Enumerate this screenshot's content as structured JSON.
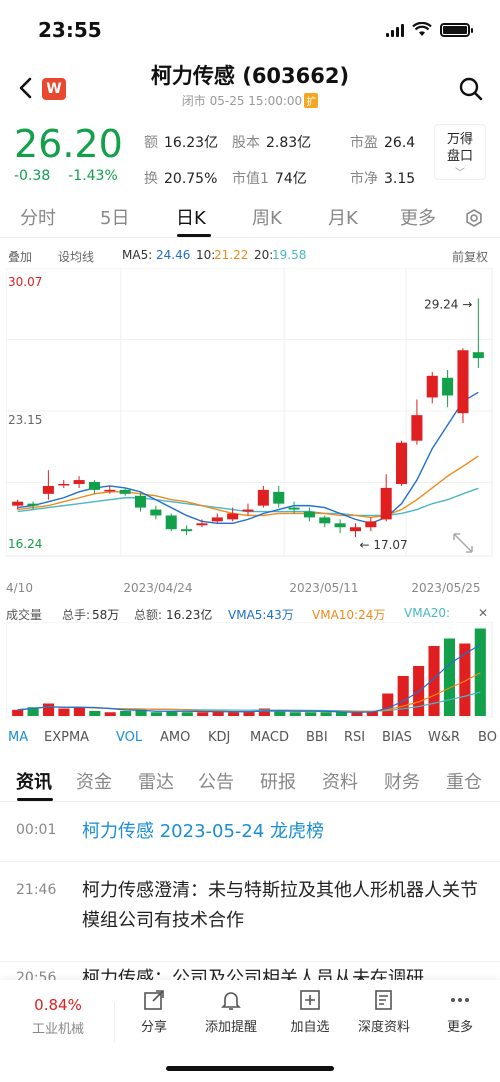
{
  "status_bar": {
    "time": "23:55"
  },
  "header": {
    "title": "柯力传感 (603662)",
    "subtitle": "闭市 05-25 15:00:00",
    "subtitle_badge": "扩",
    "logo": "W"
  },
  "quote": {
    "price": "26.20",
    "change": "-0.38",
    "change_pct": "-1.43%",
    "stats": [
      {
        "k": "额",
        "v": "16.23亿"
      },
      {
        "k": "股本",
        "v": "2.83亿"
      },
      {
        "k": "市盈",
        "v": "26.4"
      },
      {
        "k": "换",
        "v": "20.75%"
      },
      {
        "k": "市值1",
        "v": "74亿"
      },
      {
        "k": "市净",
        "v": "3.15"
      }
    ],
    "wande_btn": [
      "万得",
      "盘口"
    ]
  },
  "period_tabs": [
    "分时",
    "5日",
    "日K",
    "周K",
    "月K",
    "更多"
  ],
  "period_active": "日K",
  "ma_bar": {
    "overlay": "叠加",
    "set_line": "设均线",
    "ma5_label": "MA5:",
    "ma5": "24.46",
    "ma10_label": "10:",
    "ma10": "21.22",
    "ma20_label": "20:",
    "ma20": "19.58",
    "adjust": "前复权",
    "colors": {
      "ma5": "#1f6fd1",
      "ma10": "#f08a1a",
      "ma20": "#4ab7c8"
    }
  },
  "chart_data": {
    "type": "candlestick",
    "y_max_label": "30.07",
    "y_mid_label": "23.15",
    "y_min_label": "16.24",
    "ylim": [
      16.24,
      30.07
    ],
    "x_labels": [
      "4/10",
      "2023/04/24",
      "2023/05/11",
      "2023/05/25"
    ],
    "high_annotation": "29.24",
    "low_annotation": "17.07",
    "candles": [
      {
        "o": 18.7,
        "c": 18.9,
        "h": 19.0,
        "l": 18.5
      },
      {
        "o": 18.8,
        "c": 18.7,
        "h": 18.9,
        "l": 18.5
      },
      {
        "o": 19.3,
        "c": 19.7,
        "h": 20.5,
        "l": 19.0
      },
      {
        "o": 19.8,
        "c": 19.8,
        "h": 20.0,
        "l": 19.6
      },
      {
        "o": 19.8,
        "c": 20.0,
        "h": 20.2,
        "l": 19.6
      },
      {
        "o": 19.9,
        "c": 19.5,
        "h": 20.0,
        "l": 19.3
      },
      {
        "o": 19.5,
        "c": 19.5,
        "h": 19.7,
        "l": 19.3
      },
      {
        "o": 19.5,
        "c": 19.3,
        "h": 19.6,
        "l": 19.2
      },
      {
        "o": 19.2,
        "c": 18.6,
        "h": 19.4,
        "l": 18.4
      },
      {
        "o": 18.5,
        "c": 18.2,
        "h": 18.7,
        "l": 18.0
      },
      {
        "o": 18.2,
        "c": 17.5,
        "h": 18.3,
        "l": 17.4
      },
      {
        "o": 17.5,
        "c": 17.4,
        "h": 17.7,
        "l": 17.2
      },
      {
        "o": 17.7,
        "c": 17.8,
        "h": 18.0,
        "l": 17.6
      },
      {
        "o": 17.9,
        "c": 18.1,
        "h": 18.3,
        "l": 17.8
      },
      {
        "o": 18.0,
        "c": 18.3,
        "h": 18.6,
        "l": 17.9
      },
      {
        "o": 18.4,
        "c": 18.5,
        "h": 18.8,
        "l": 18.2
      },
      {
        "o": 18.7,
        "c": 19.5,
        "h": 19.7,
        "l": 18.6
      },
      {
        "o": 19.4,
        "c": 18.8,
        "h": 19.7,
        "l": 18.6
      },
      {
        "o": 18.6,
        "c": 18.5,
        "h": 18.9,
        "l": 18.3
      },
      {
        "o": 18.4,
        "c": 18.1,
        "h": 18.6,
        "l": 17.9
      },
      {
        "o": 18.1,
        "c": 17.8,
        "h": 18.2,
        "l": 17.6
      },
      {
        "o": 17.8,
        "c": 17.6,
        "h": 18.0,
        "l": 17.3
      },
      {
        "o": 17.4,
        "c": 17.6,
        "h": 17.8,
        "l": 17.1
      },
      {
        "o": 17.6,
        "c": 17.9,
        "h": 18.1,
        "l": 17.4
      },
      {
        "o": 18.0,
        "c": 19.6,
        "h": 20.3,
        "l": 17.9
      },
      {
        "o": 19.8,
        "c": 21.9,
        "h": 22.0,
        "l": 19.7
      },
      {
        "o": 22.0,
        "c": 23.3,
        "h": 24.1,
        "l": 21.8
      },
      {
        "o": 24.2,
        "c": 25.3,
        "h": 25.5,
        "l": 23.9
      },
      {
        "o": 25.2,
        "c": 24.3,
        "h": 25.6,
        "l": 23.7
      },
      {
        "o": 23.4,
        "c": 26.6,
        "h": 26.7,
        "l": 22.9
      },
      {
        "o": 26.5,
        "c": 26.2,
        "h": 29.24,
        "l": 25.7
      }
    ],
    "ma5": [
      18.6,
      18.7,
      18.9,
      19.1,
      19.4,
      19.6,
      19.7,
      19.6,
      19.4,
      19.0,
      18.6,
      18.2,
      17.9,
      17.8,
      17.8,
      18.0,
      18.3,
      18.5,
      18.7,
      18.7,
      18.6,
      18.3,
      18.0,
      17.8,
      18.1,
      18.8,
      20.0,
      21.6,
      22.8,
      24.0,
      24.46
    ],
    "ma10": [
      18.5,
      18.6,
      18.7,
      18.9,
      19.1,
      19.3,
      19.4,
      19.4,
      19.3,
      19.2,
      19.0,
      18.9,
      18.7,
      18.5,
      18.3,
      18.2,
      18.2,
      18.3,
      18.3,
      18.3,
      18.3,
      18.2,
      18.2,
      18.1,
      18.2,
      18.5,
      19.0,
      19.6,
      20.2,
      20.7,
      21.22
    ],
    "ma20": [
      18.4,
      18.5,
      18.6,
      18.7,
      18.8,
      18.9,
      19.0,
      19.1,
      19.1,
      19.0,
      18.9,
      18.8,
      18.7,
      18.6,
      18.5,
      18.4,
      18.4,
      18.4,
      18.4,
      18.4,
      18.3,
      18.3,
      18.2,
      18.2,
      18.2,
      18.3,
      18.5,
      18.8,
      19.0,
      19.3,
      19.58
    ]
  },
  "volume": {
    "header": {
      "title": "成交量",
      "hand_label": "总手:",
      "hand": "58万",
      "amount_label": "总额:",
      "amount": "16.23亿",
      "vma5": "VMA5:43万",
      "vma10": "VMA10:24万",
      "vma20": "VMA20:"
    },
    "values": [
      5,
      7,
      10,
      6,
      7,
      4,
      3,
      4,
      5,
      3,
      4,
      3,
      3,
      4,
      3,
      4,
      6,
      4,
      3,
      3,
      3,
      3,
      3,
      4,
      18,
      32,
      40,
      56,
      62,
      58,
      70
    ]
  },
  "indicator_tabs": [
    "MA",
    "EXPMA",
    "VOL",
    "AMO",
    "KDJ",
    "MACD",
    "BBI",
    "RSI",
    "BIAS",
    "W&R",
    "BO"
  ],
  "indicator_active": [
    "MA",
    "VOL"
  ],
  "info_tabs": [
    "资讯",
    "资金",
    "雷达",
    "公告",
    "研报",
    "资料",
    "财务",
    "重仓"
  ],
  "info_active": "资讯",
  "news": [
    {
      "time": "00:01",
      "title": "柯力传感 2023-05-24 龙虎榜"
    },
    {
      "time": "21:46",
      "title": "柯力传感澄清：未与特斯拉及其他人形机器人关节模组公司有技术合作"
    },
    {
      "time": "20:56",
      "title": "柯力传感：公司及公司相关人员从未在调研"
    }
  ],
  "bottom_bar": {
    "sector_pct": "0.84%",
    "sector_name": "工业机械",
    "actions": [
      "分享",
      "添加提醒",
      "加自选",
      "深度资料",
      "更多"
    ]
  }
}
